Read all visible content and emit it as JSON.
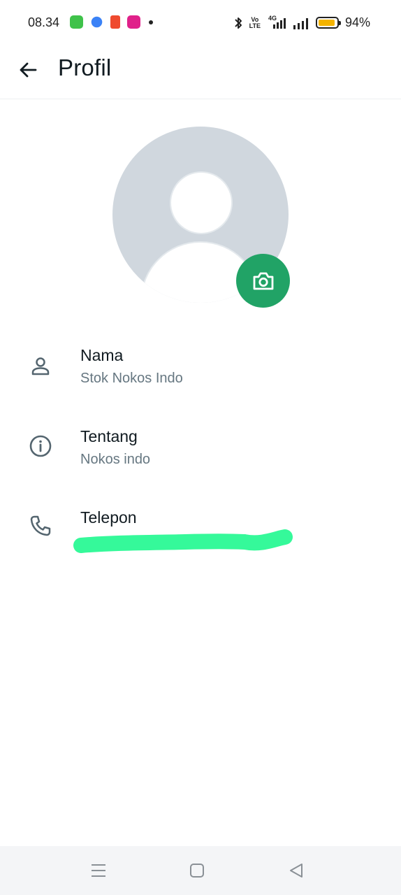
{
  "status_bar": {
    "time": "08.34",
    "network_volte_top": "Vo",
    "network_volte_bottom": "LTE",
    "network_type": "4G",
    "battery_percent": "94%",
    "battery_level": 0.94,
    "notification_icons": [
      "app-icon-green",
      "app-icon-blue",
      "app-icon-orange",
      "app-icon-pink",
      "more-dot-icon"
    ],
    "status_icons": [
      "bluetooth-icon",
      "volte-icon",
      "signal-4g-icon",
      "signal-icon",
      "battery-icon"
    ]
  },
  "app_bar": {
    "title": "Profil",
    "back_icon": "arrow-left-icon"
  },
  "profile": {
    "avatar_icon": "default-avatar-icon",
    "camera_icon": "camera-icon",
    "accent_color": "#21a366"
  },
  "fields": {
    "nama": {
      "label": "Nama",
      "value": "Stok Nokos Indo",
      "icon": "person-icon"
    },
    "tentang": {
      "label": "Tentang",
      "value": "Nokos indo",
      "icon": "info-icon"
    },
    "telepon": {
      "label": "Telepon",
      "icon": "phone-icon",
      "redaction_color": "#35f99a"
    }
  },
  "nav_bar": {
    "icons": [
      "menu-icon",
      "home-square-icon",
      "back-triangle-icon"
    ]
  }
}
